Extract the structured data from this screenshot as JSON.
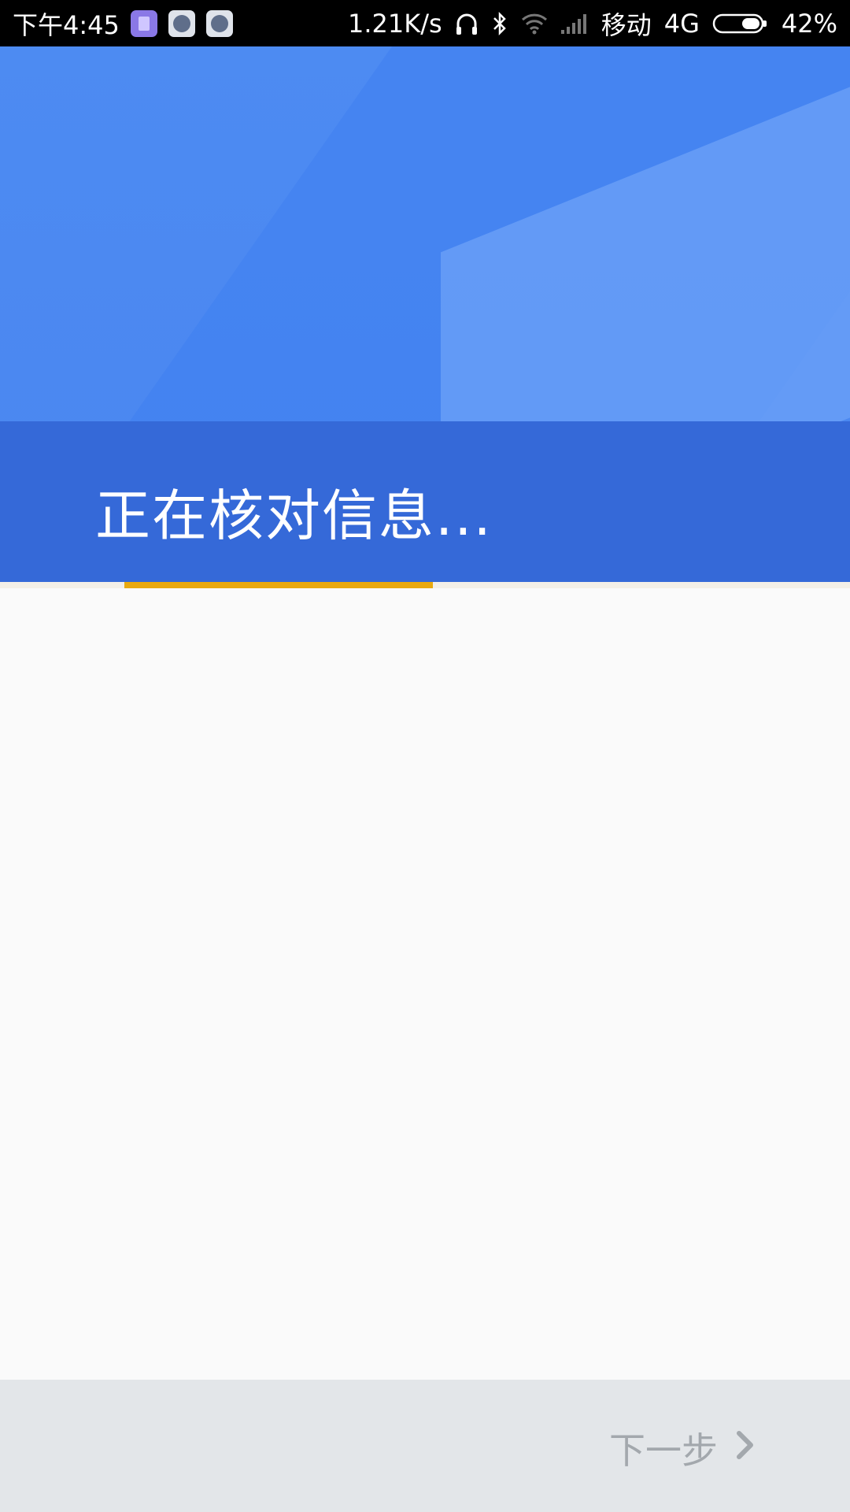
{
  "status_bar": {
    "time": "下午4:45",
    "net_speed": "1.21K/s",
    "carrier": "移动",
    "network_type": "4G",
    "battery": "42%",
    "apps": [
      "app-icon",
      "telegram-icon",
      "telegram-icon"
    ]
  },
  "header": {
    "title": "正在核对信息..."
  },
  "progress": {
    "color": "#e9a90f"
  },
  "footer": {
    "next_label": "下一步"
  },
  "colors": {
    "header_blue": "#4a86f0",
    "band_blue": "#3569d8",
    "footer_bg": "#e3e6e9"
  }
}
